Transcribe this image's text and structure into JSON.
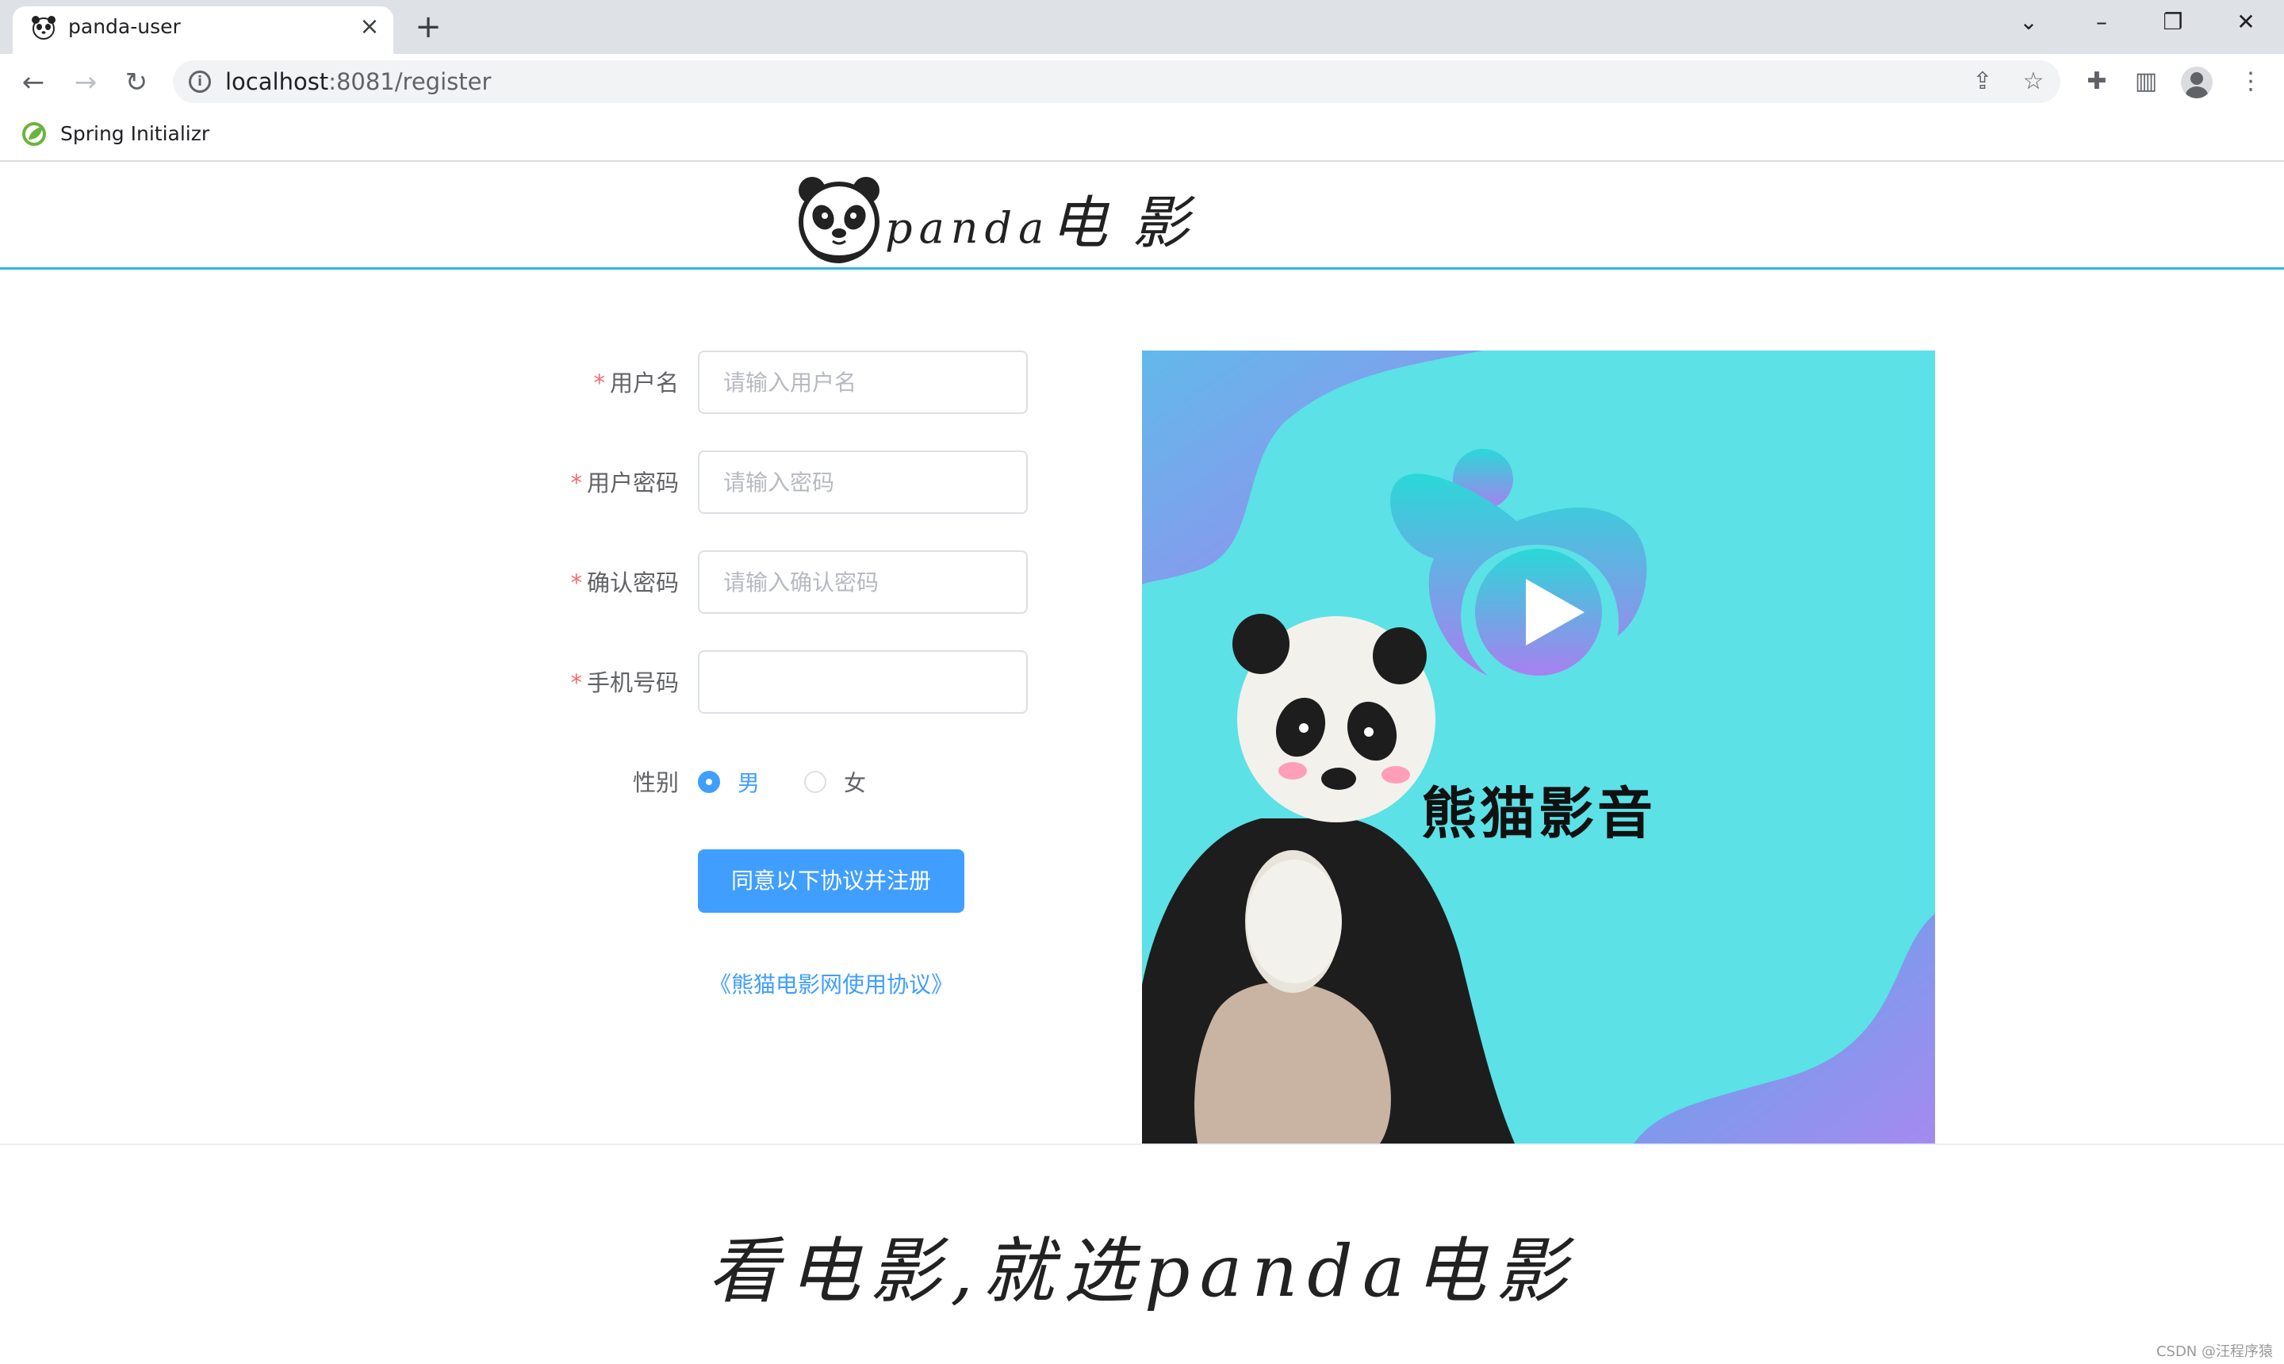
{
  "browser": {
    "tab_title": "panda-user",
    "tab_close": "×",
    "new_tab": "+",
    "url_host": "localhost",
    "url_path": ":8081/register",
    "bookmark_label": "Spring Initializr"
  },
  "header": {
    "logo_latin": "panda",
    "logo_cjk": "电 影"
  },
  "form": {
    "username": {
      "label": "用户名",
      "placeholder": "请输入用户名",
      "required": "*"
    },
    "password": {
      "label": "用户密码",
      "placeholder": "请输入密码",
      "required": "*"
    },
    "confirm": {
      "label": "确认密码",
      "placeholder": "请输入确认密码",
      "required": "*"
    },
    "phone": {
      "label": "手机号码",
      "placeholder": "",
      "required": "*"
    },
    "gender": {
      "label": "性别",
      "options": [
        "男",
        "女"
      ],
      "selected": "男"
    },
    "submit_label": "同意以下协议并注册",
    "agreement_link": "《熊猫电影网使用协议》"
  },
  "promo": {
    "title": "熊猫影音"
  },
  "footer": {
    "slogan": "看电影,就选panda电影",
    "watermark": "CSDN @汪程序猿"
  },
  "colors": {
    "accent": "#409eff",
    "header_line": "#2fb6e9",
    "promo_bg": "#5ce1e6",
    "required": "#f56c6c"
  }
}
